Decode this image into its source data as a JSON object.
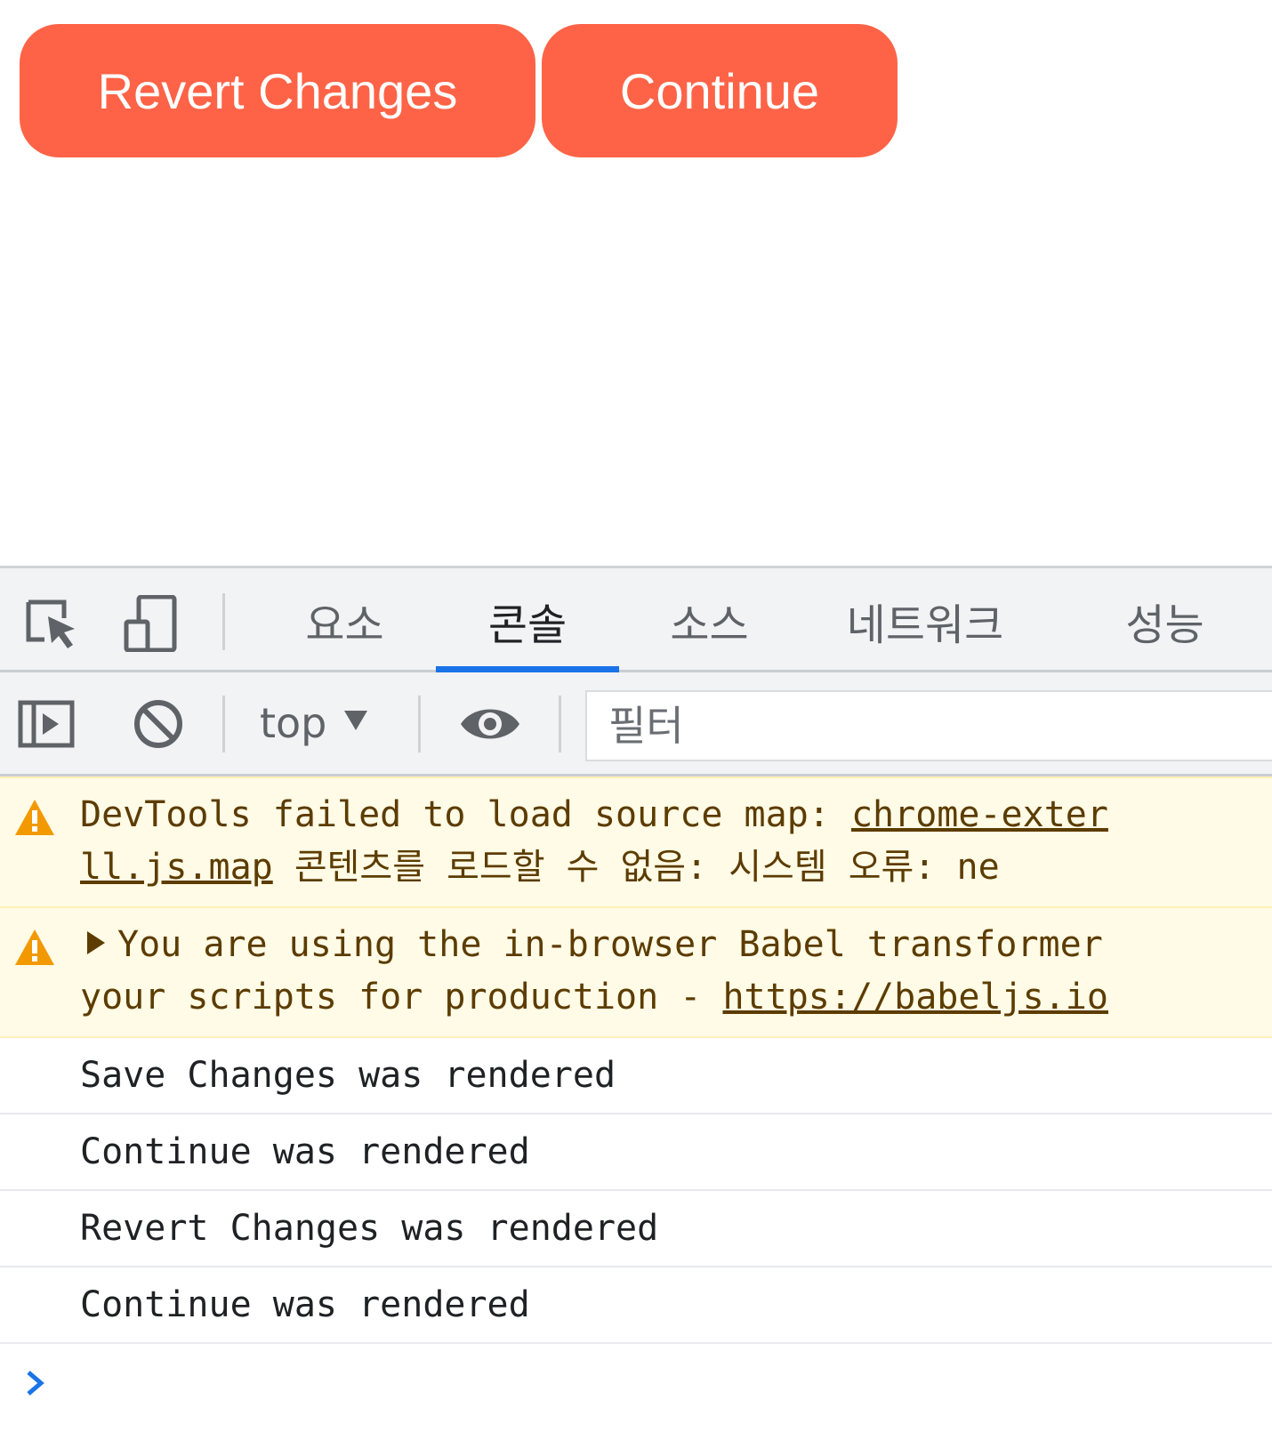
{
  "page": {
    "buttons": {
      "revert_label": "Revert Changes",
      "continue_label": "Continue"
    },
    "button_color": "#ff6347"
  },
  "devtools": {
    "icons": {
      "inspect": "inspect-element-icon",
      "device": "device-toolbar-icon",
      "sidebar": "show-sidebar-icon",
      "clear": "clear-console-icon",
      "live_expression": "eye-icon",
      "warning": "warning-icon",
      "prompt": "chevron-right-icon"
    },
    "tabs": [
      {
        "label": "요소"
      },
      {
        "label": "콘솔",
        "active": true
      },
      {
        "label": "소스"
      },
      {
        "label": "네트워크"
      },
      {
        "label": "성능"
      }
    ],
    "toolbar": {
      "context": "top",
      "filter_placeholder": "필터"
    },
    "accent": "#1a73e8",
    "messages": {
      "warn1": {
        "text": "DevTools failed to load source map: ",
        "link": "chrome-exter",
        "link2": "ll.js.map",
        "text2": " 콘텐츠를 로드할 수 없음: 시스템 오류: ne"
      },
      "warn2": {
        "text": "You are using the in-browser Babel transformer",
        "text2": "your scripts for production - ",
        "link": "https://babeljs.io"
      },
      "logs": [
        "Save Changes was rendered",
        "Continue was rendered",
        "Revert Changes was rendered",
        "Continue was rendered"
      ]
    },
    "warning_bg": "#fffbe6"
  }
}
